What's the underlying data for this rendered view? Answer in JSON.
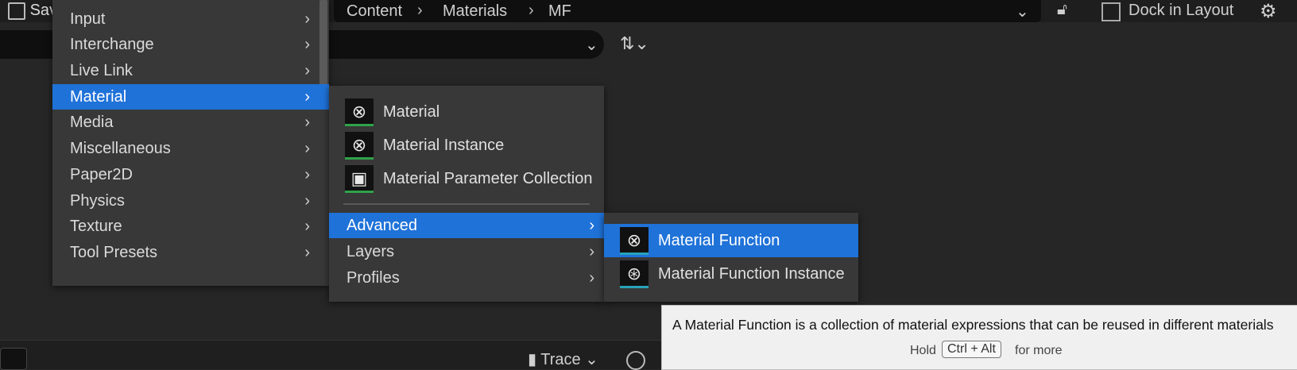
{
  "header": {
    "save_label": "Sav",
    "breadcrumbs": [
      "Content",
      "Materials",
      "MF"
    ],
    "dock_label": "Dock in Layout"
  },
  "icons": {
    "save": "floppy-disk-icon",
    "lock": "lock-icon",
    "layout": "layout-icon",
    "settings": "gear-icon",
    "sort": "sort-icon",
    "chevron": "chevron-down-icon",
    "arrow": "chevron-right-icon"
  },
  "colors": {
    "selection": "#1f72d8",
    "menu_bg": "#383838",
    "green_underline": "#2fa34a",
    "cyan_underline": "#27a3b8"
  },
  "menu1": {
    "items": [
      "Input",
      "Interchange",
      "Live Link",
      "Material",
      "Media",
      "Miscellaneous",
      "Paper2D",
      "Physics",
      "Texture",
      "Tool Presets"
    ],
    "selected": "Material"
  },
  "menu2": {
    "items": [
      "Material",
      "Material Instance",
      "Material Parameter Collection"
    ],
    "submenus": [
      "Advanced",
      "Layers",
      "Profiles"
    ],
    "selected": "Advanced"
  },
  "menu3": {
    "items": [
      "Material Function",
      "Material Function Instance"
    ],
    "selected": "Material Function"
  },
  "tooltip": {
    "text": "A Material Function is a collection of material expressions that can be reused in different materials",
    "hold": "Hold",
    "keys": "Ctrl + Alt",
    "more": "for more"
  },
  "bottom": {
    "trace_label": "Trace"
  }
}
